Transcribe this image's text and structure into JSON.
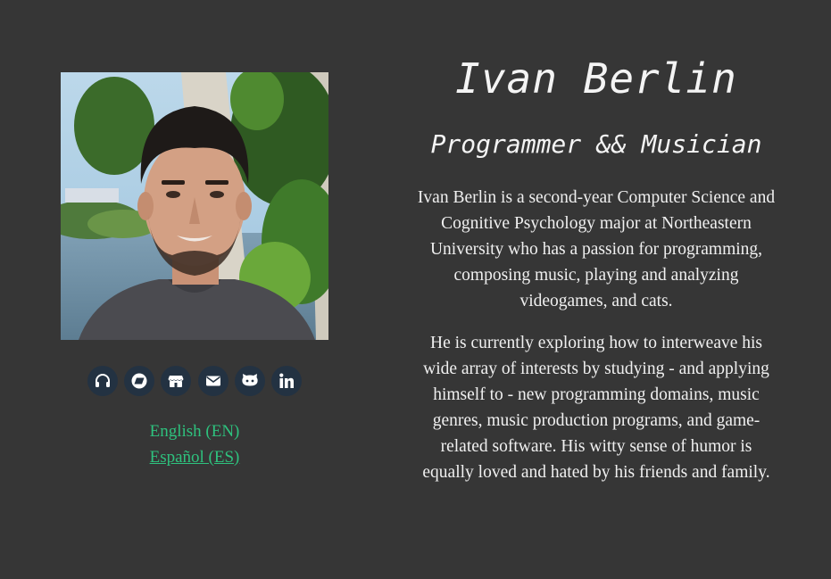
{
  "profile": {
    "name": "Ivan Berlin",
    "tagline": "Programmer && Musician",
    "bio": [
      "Ivan Berlin is a second-year Computer Science and Cognitive Psychology major at Northeastern University who has a passion for programming, composing music, playing and analyzing videogames, and cats.",
      "He is currently exploring how to interweave his wide array of interests by studying - and applying himself to - new programming domains, music genres, music production programs, and game-related software. His witty sense of humor is equally loved and hated by his friends and family."
    ]
  },
  "social_links": [
    {
      "icon": "headphones-icon"
    },
    {
      "icon": "bandcamp-icon"
    },
    {
      "icon": "itchio-icon"
    },
    {
      "icon": "email-icon"
    },
    {
      "icon": "github-icon"
    },
    {
      "icon": "linkedin-icon"
    }
  ],
  "languages": [
    {
      "label": "English (EN)"
    },
    {
      "label": "Español (ES)"
    }
  ],
  "colors": {
    "background": "#363636",
    "accent": "#2ec27e",
    "icon_bg": "#233242",
    "text": "#f2f2f2"
  }
}
